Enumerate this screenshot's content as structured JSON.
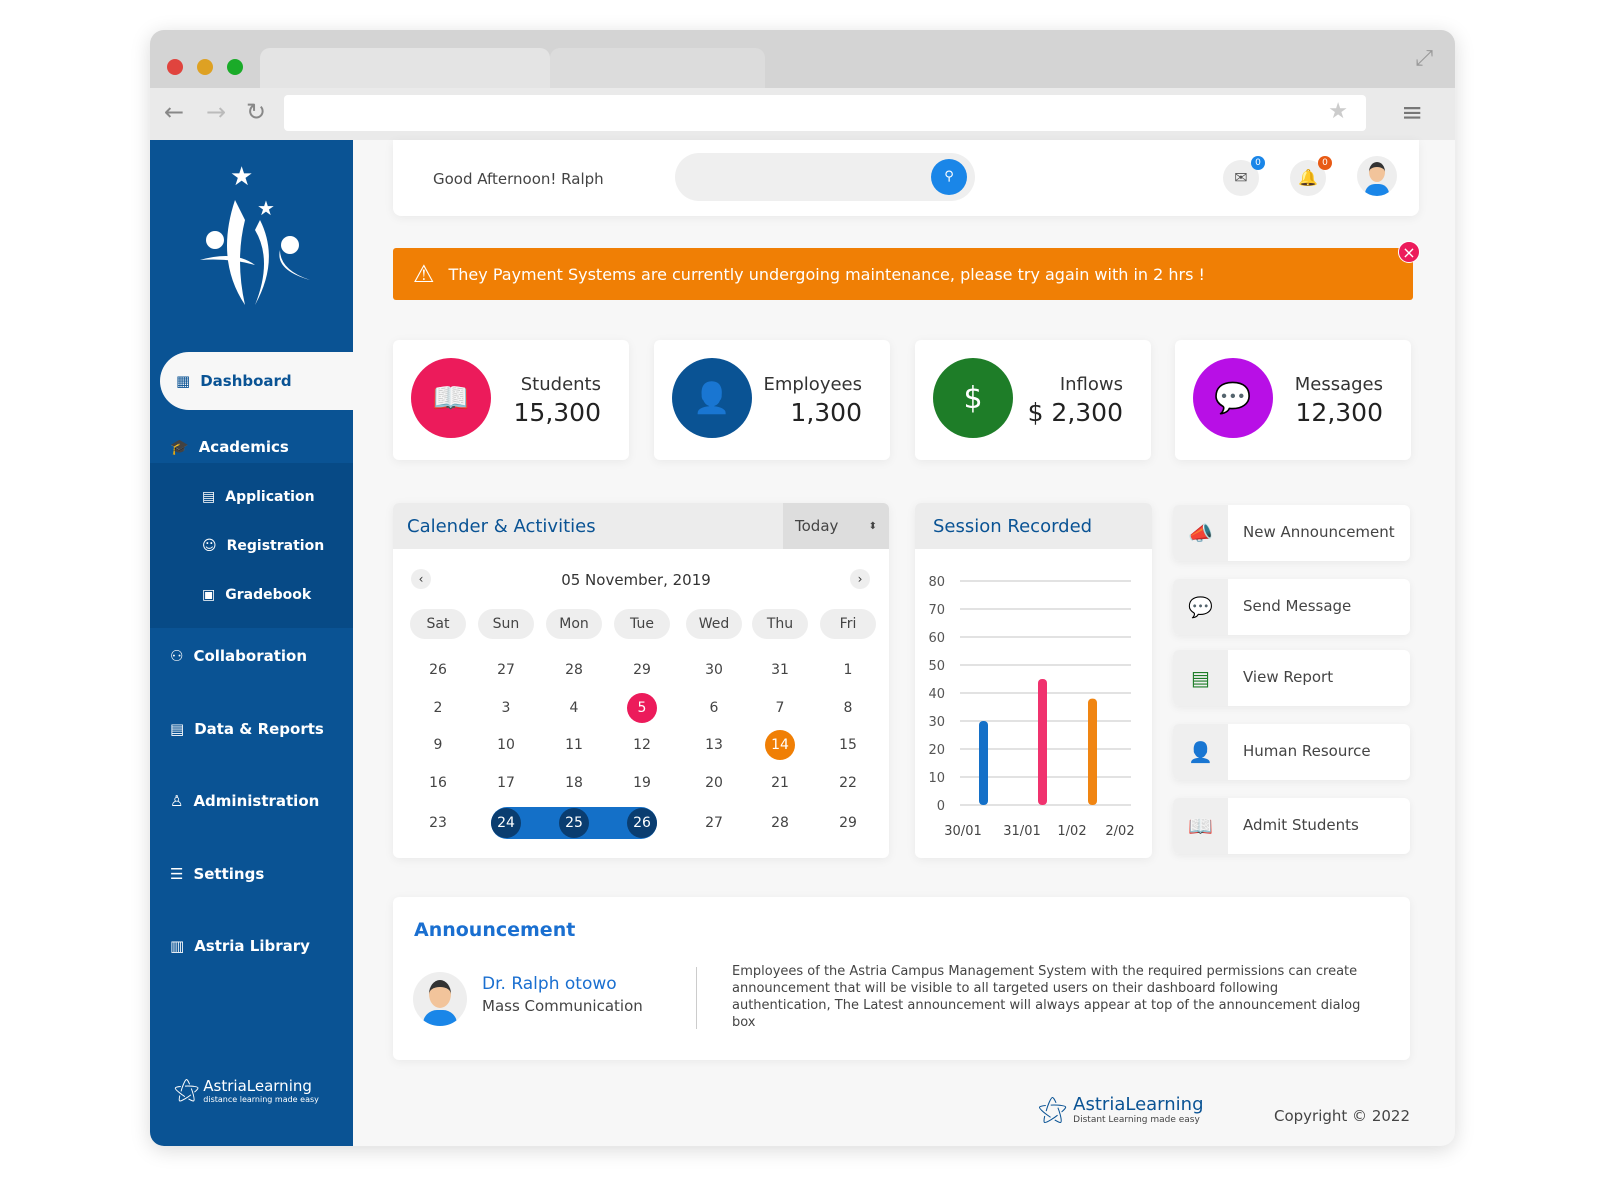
{
  "header": {
    "greeting": "Good Afternoon!  Ralph",
    "mail_count": "0",
    "notif_count": "0"
  },
  "alert": {
    "message": "They Payment Systems are currently undergoing maintenance, please try again with in 2 hrs !",
    "close": "×"
  },
  "sidebar": {
    "active": "Dashboard",
    "items": [
      {
        "label": "Academics"
      },
      {
        "label": "Collaboration"
      },
      {
        "label": "Data & Reports"
      },
      {
        "label": "Administration"
      },
      {
        "label": "Settings"
      },
      {
        "label": "Astria Library"
      }
    ],
    "sub_items": [
      {
        "label": "Application"
      },
      {
        "label": "Registration"
      },
      {
        "label": "Gradebook"
      }
    ],
    "footer_brand": "AstriaLearning",
    "footer_tagline": "distance learning made easy"
  },
  "stats": [
    {
      "label": "Students",
      "value": "15,300",
      "color": "#ec1b5b"
    },
    {
      "label": "Employees",
      "value": "1,300",
      "color": "#0a5394"
    },
    {
      "label": "Inflows",
      "value": "$ 2,300",
      "color": "#1e7d28"
    },
    {
      "label": "Messages",
      "value": "12,300",
      "color": "#b80fe6"
    }
  ],
  "calendar": {
    "title": "Calender & Activities",
    "filter": "Today",
    "month": "05 November, 2019",
    "weekdays": [
      "Sat",
      "Sun",
      "Mon",
      "Tue",
      "Wed",
      "Thu",
      "Fri"
    ],
    "weeks": [
      [
        "26",
        "27",
        "28",
        "29",
        "30",
        "31",
        "1"
      ],
      [
        "2",
        "3",
        "4",
        "5",
        "6",
        "7",
        "8"
      ],
      [
        "9",
        "10",
        "11",
        "12",
        "13",
        "14",
        "15"
      ],
      [
        "16",
        "17",
        "18",
        "19",
        "20",
        "21",
        "22"
      ],
      [
        "23",
        "24",
        "25",
        "26",
        "27",
        "28",
        "29"
      ]
    ]
  },
  "chart_data": {
    "type": "bar",
    "title": "Session Recorded",
    "categories": [
      "30/01",
      "31/01",
      "1/02",
      "2/02"
    ],
    "values": [
      30,
      45,
      38,
      0
    ],
    "colors": [
      "#1470c8",
      "#f0326e",
      "#f08512"
    ],
    "yticks": [
      "0",
      "10",
      "20",
      "30",
      "40",
      "50",
      "60",
      "70",
      "80"
    ],
    "ylim": [
      0,
      80
    ],
    "grid": true
  },
  "quick_actions": [
    {
      "label": "New Announcement"
    },
    {
      "label": "Send Message"
    },
    {
      "label": "View Report"
    },
    {
      "label": "Human Resource"
    },
    {
      "label": "Admit Students"
    }
  ],
  "announcement": {
    "title": "Announcement",
    "author": "Dr. Ralph otowo",
    "department": "Mass Communication",
    "body": "Employees of the Astria Campus Management System with the required permissions can create announcement that will be visible to all targeted users on their dashboard following authentication, The Latest announcement will always appear at top of the announcement dialog box"
  },
  "footer": {
    "brand": "AstriaLearning",
    "tagline": "Distant Learning made easy",
    "copyright": "Copyright © 2022"
  }
}
